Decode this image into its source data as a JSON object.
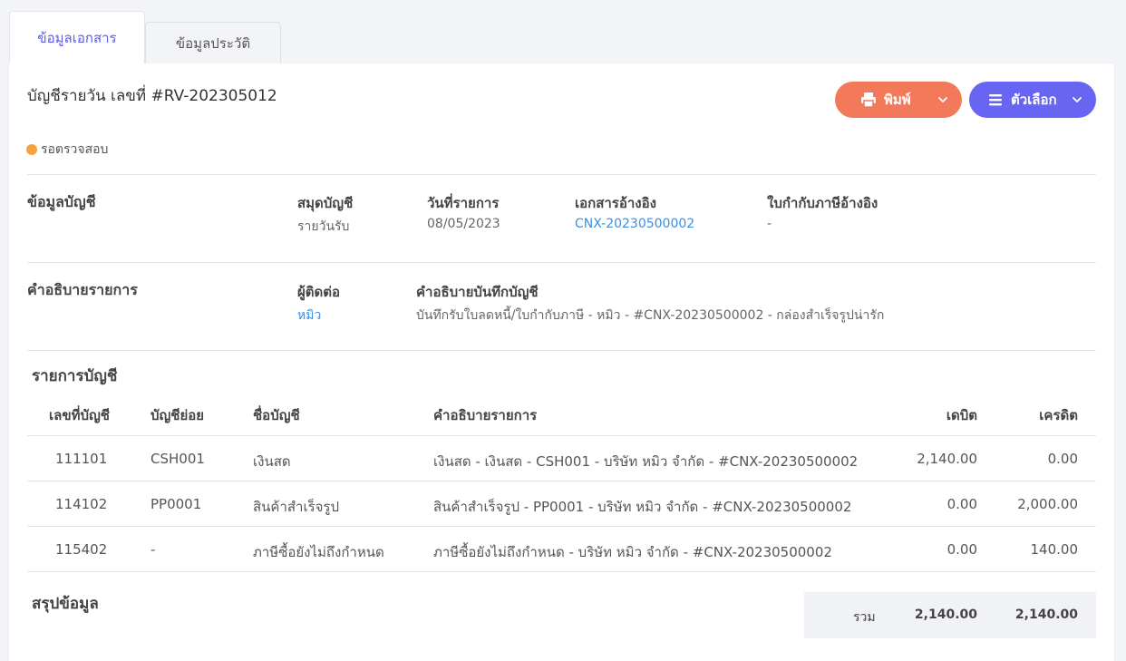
{
  "tabs": [
    {
      "label": "ข้อมูลเอกสาร"
    },
    {
      "label": "ข้อมูลประวัติ"
    }
  ],
  "document": {
    "title": "บัญชีรายวัน เลขที่ #RV-202305012",
    "status": "รอตรวจสอบ"
  },
  "actions": {
    "print_label": "พิมพ์",
    "options_label": "ตัวเลือก"
  },
  "account_info": {
    "section_label": "ข้อมูลบัญชี",
    "fields": [
      {
        "key": "สมุดบัญชี",
        "value": "รายวันรับ"
      },
      {
        "key": "วันที่รายการ",
        "value": "08/05/2023"
      },
      {
        "key": "เอกสารอ้างอิง",
        "value": "CNX-20230500002"
      },
      {
        "key": "ใบกำกับภาษีอ้างอิง",
        "value": "-"
      }
    ]
  },
  "description": {
    "section_label": "คำอธิบายรายการ",
    "contact_key": "ผู้ติดต่อ",
    "contact_value": "หมิว",
    "note_key": "คำอธิบายบันทึกบัญชี",
    "note_value": "บันทึกรับใบลดหนี้/ใบกำกับภาษี - หมิว - #CNX-20230500002 - กล่องสำเร็จรูปน่ารัก"
  },
  "entries": {
    "title": "รายการบัญชี",
    "columns": [
      "เลขที่บัญชี",
      "บัญชีย่อย",
      "ชื่อบัญชี",
      "คำอธิบายรายการ",
      "เดบิต",
      "เครดิต"
    ],
    "rows": [
      {
        "acct": "111101",
        "sub": "CSH001",
        "name": "เงินสด",
        "desc": "เงินสด - เงินสด - CSH001 - บริษัท หมิว จำกัด - #CNX-20230500002",
        "debit": "2,140.00",
        "credit": "0.00"
      },
      {
        "acct": "114102",
        "sub": "PP0001",
        "name": "สินค้าสำเร็จรูป",
        "desc": "สินค้าสำเร็จรูป - PP0001 - บริษัท หมิว จำกัด - #CNX-20230500002",
        "debit": "0.00",
        "credit": "2,000.00"
      },
      {
        "acct": "115402",
        "sub": "-",
        "name": "ภาษีซื้อยังไม่ถึงกำหนด",
        "desc": "ภาษีซื้อยังไม่ถึงกำหนด - บริษัท หมิว จำกัด - #CNX-20230500002",
        "debit": "0.00",
        "credit": "140.00"
      }
    ]
  },
  "summary": {
    "title": "สรุปข้อมูล",
    "total_label": "รวม",
    "total_debit": "2,140.00",
    "total_credit": "2,140.00"
  },
  "colors": {
    "accent": "#5b5be6",
    "print_button": "#f2795a",
    "options_button": "#6865f2",
    "status_pending": "#f7a23b",
    "link": "#3a8ee6"
  }
}
